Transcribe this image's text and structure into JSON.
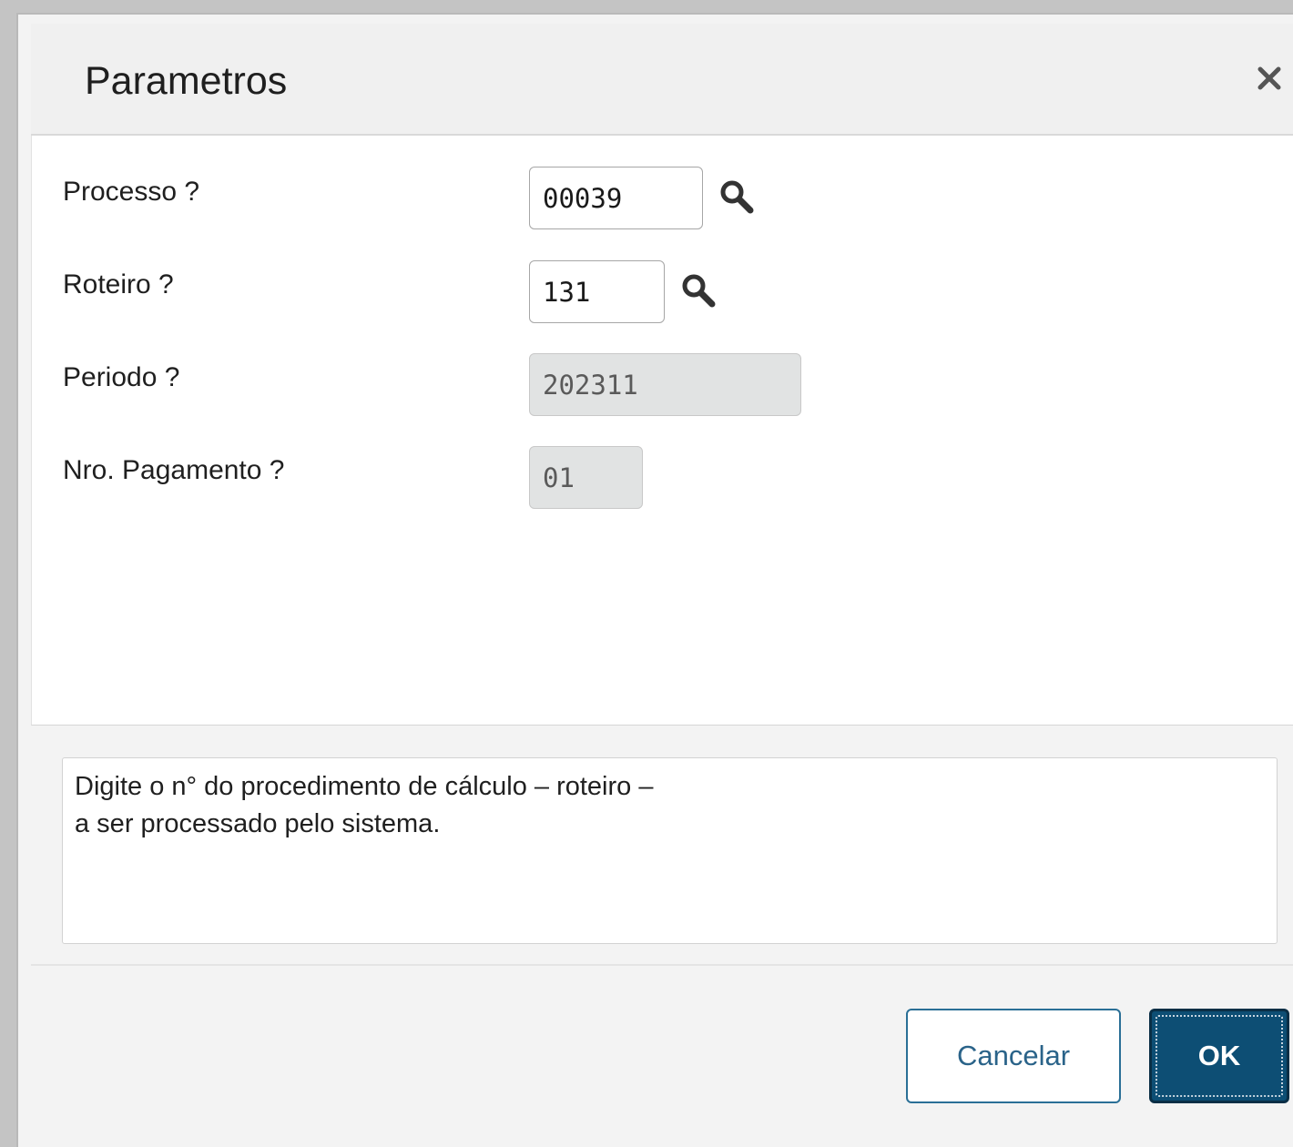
{
  "dialog": {
    "title": "Parametros",
    "close_icon": "close-icon"
  },
  "form": {
    "fields": [
      {
        "label": "Processo ?",
        "value": "00039",
        "readonly": false,
        "lookup": true
      },
      {
        "label": "Roteiro ?",
        "value": "131",
        "readonly": false,
        "lookup": true
      },
      {
        "label": "Periodo ?",
        "value": "202311",
        "readonly": true,
        "lookup": false
      },
      {
        "label": "Nro. Pagamento ?",
        "value": "01",
        "readonly": true,
        "lookup": false
      }
    ]
  },
  "help": {
    "line1": "Digite o n° do procedimento de cálculo – roteiro –",
    "line2": "a ser processado pelo sistema."
  },
  "footer": {
    "cancel_label": "Cancelar",
    "ok_label": "OK"
  },
  "colors": {
    "primary": "#0d4e74",
    "cancel_text": "#2a6389",
    "readonly_bg": "#e1e3e3"
  }
}
